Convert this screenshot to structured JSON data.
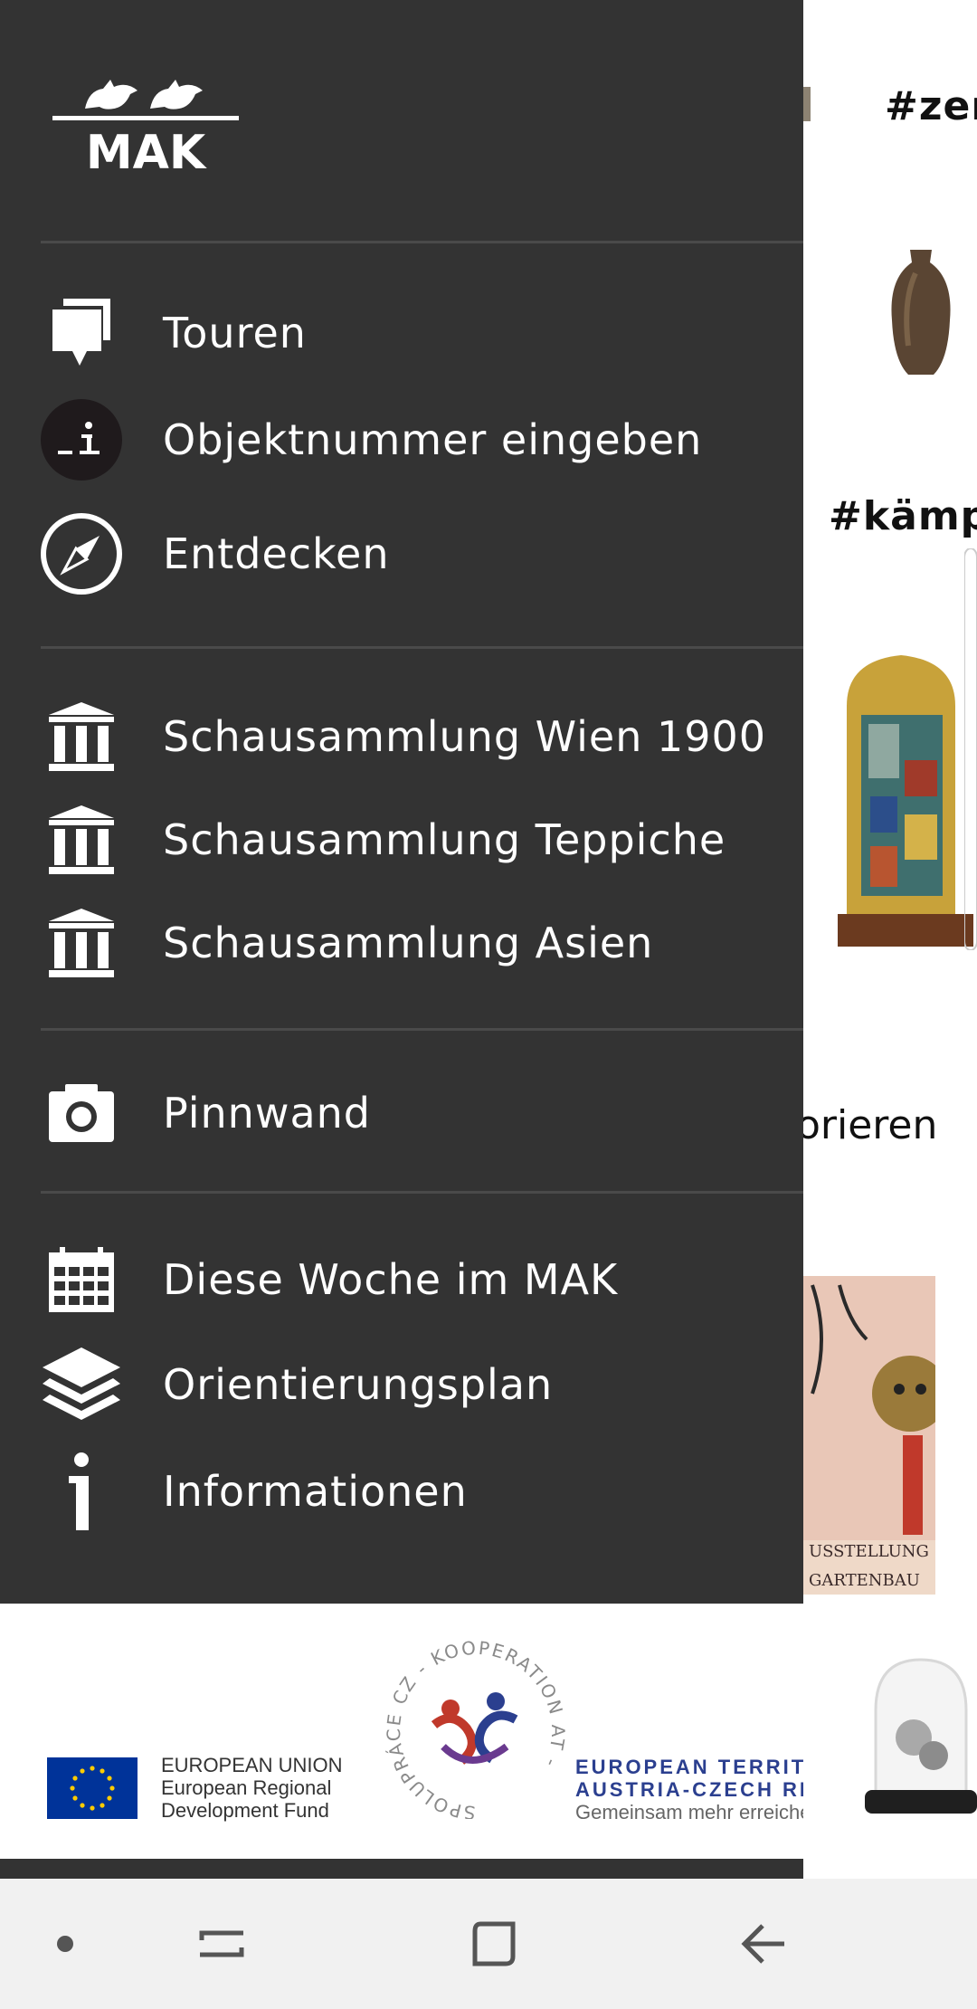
{
  "background": {
    "tag1": "#zers",
    "tag2": "#kämpf",
    "text3": "orieren"
  },
  "drawer": {
    "logo_text": "MAK",
    "sections": [
      {
        "items": [
          {
            "label": "Touren",
            "icon": "tours-icon"
          },
          {
            "label": "Objektnummer eingeben",
            "icon": "info-number-icon"
          },
          {
            "label": "Entdecken",
            "icon": "compass-icon"
          }
        ]
      },
      {
        "items": [
          {
            "label": "Schausammlung Wien 1900",
            "icon": "museum-icon"
          },
          {
            "label": "Schausammlung Teppiche",
            "icon": "museum-icon"
          },
          {
            "label": "Schausammlung Asien",
            "icon": "museum-icon"
          }
        ]
      },
      {
        "items": [
          {
            "label": "Pinnwand",
            "icon": "camera-icon"
          }
        ]
      },
      {
        "items": [
          {
            "label": "Diese Woche im MAK",
            "icon": "calendar-icon"
          },
          {
            "label": "Orientierungsplan",
            "icon": "layers-icon"
          },
          {
            "label": "Informationen",
            "icon": "info-icon"
          }
        ]
      }
    ],
    "footer": {
      "eu_line1": "EUROPEAN UNION",
      "eu_line2": "European Regional",
      "eu_line3": "Development Fund",
      "coop_ring": "SPOLUPRÁCE CZ - KOOPERATION AT -",
      "et_line1": "EUROPEAN TERRITO",
      "et_line2": "AUSTRIA-CZECH RE",
      "et_line3": "Gemeinsam mehr erreichen"
    }
  },
  "colors": {
    "drawer_bg": "#333333",
    "divider": "#4a4a4a",
    "text": "#ffffff",
    "eu_blue": "#003399",
    "eu_yellow": "#ffcc00",
    "navbar_bg": "#f1f1f1"
  },
  "navbar": {
    "dot": "dot-icon",
    "recents": "recents-icon",
    "home": "home-icon",
    "back": "back-icon"
  }
}
